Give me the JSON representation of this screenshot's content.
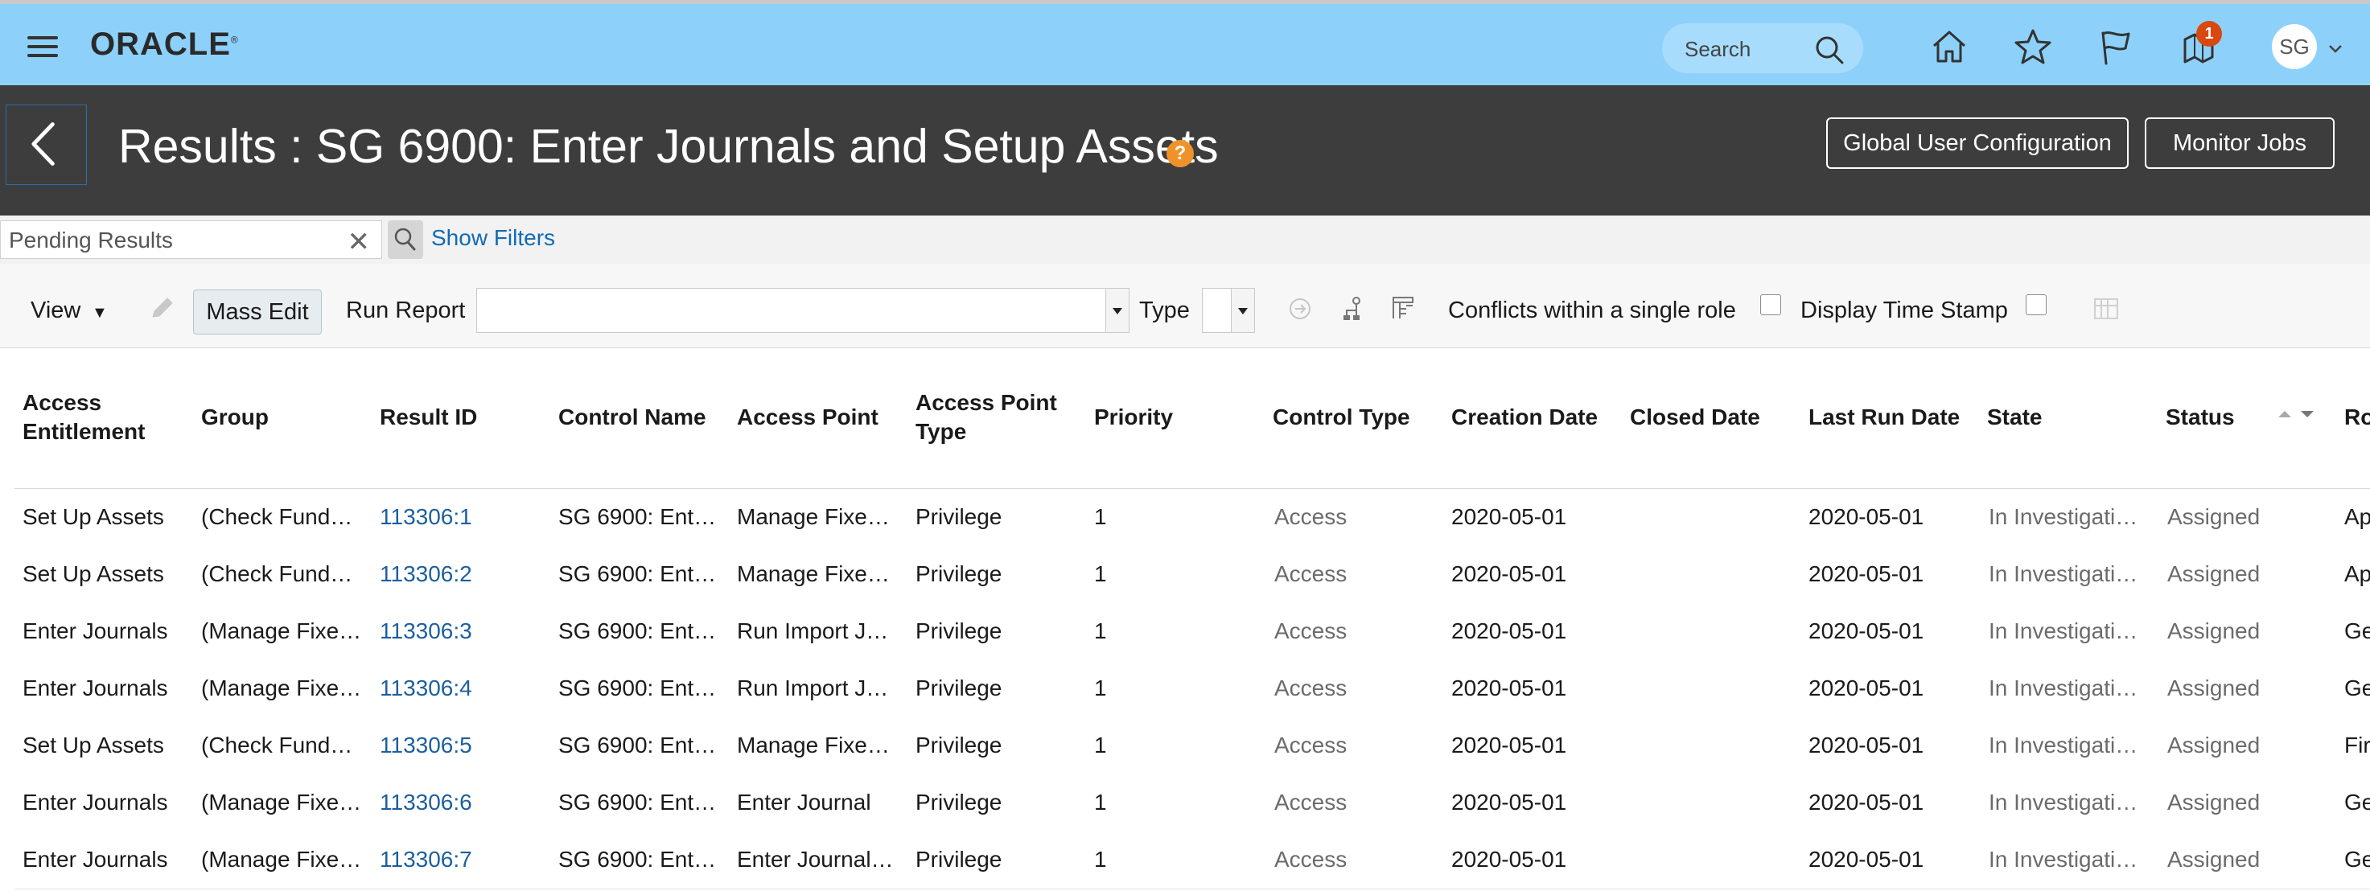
{
  "header": {
    "logo_text": "ORACLE",
    "search_placeholder": "Search",
    "notification_count": "1",
    "avatar_initials": "SG"
  },
  "titlebar": {
    "title": "Results : SG 6900: Enter Journals and Setup Assets",
    "help_glyph": "?",
    "global_config_label": "Global User Configuration",
    "monitor_jobs_label": "Monitor Jobs"
  },
  "filters": {
    "saved_search": "Pending Results",
    "show_filters_label": "Show Filters"
  },
  "toolbar": {
    "view_label": "View",
    "mass_edit_label": "Mass Edit",
    "run_report_label": "Run Report",
    "run_report_value": "",
    "type_label": "Type",
    "type_value": "",
    "conflicts_label": "Conflicts within a single role",
    "timestamp_label": "Display Time Stamp"
  },
  "table": {
    "columns": {
      "access_entitlement": "Access Entitlement",
      "group": "Group",
      "result_id": "Result ID",
      "control_name": "Control Name",
      "access_point": "Access Point",
      "access_point_type": "Access Point Type",
      "priority": "Priority",
      "control_type": "Control Type",
      "creation_date": "Creation Date",
      "closed_date": "Closed Date",
      "last_run_date": "Last Run Date",
      "state": "State",
      "status": "Status",
      "role_partial": "Ro"
    },
    "rows": [
      {
        "entitlement": "Set Up Assets",
        "group": "(Check Fund…",
        "result_id": "113306:1",
        "control": "SG 6900: Ent…",
        "access_point": "Manage Fixe…",
        "ap_type": "Privilege",
        "priority": "1",
        "control_type": "Access",
        "created": "2020-05-01",
        "closed": "",
        "last_run": "2020-05-01",
        "state": "In Investigati…",
        "status": "Assigned",
        "role": "Ap"
      },
      {
        "entitlement": "Set Up Assets",
        "group": "(Check Fund…",
        "result_id": "113306:2",
        "control": "SG 6900: Ent…",
        "access_point": "Manage Fixe…",
        "ap_type": "Privilege",
        "priority": "1",
        "control_type": "Access",
        "created": "2020-05-01",
        "closed": "",
        "last_run": "2020-05-01",
        "state": "In Investigati…",
        "status": "Assigned",
        "role": "Ap"
      },
      {
        "entitlement": "Enter Journals",
        "group": "(Manage Fixe…",
        "result_id": "113306:3",
        "control": "SG 6900: Ent…",
        "access_point": "Run Import J…",
        "ap_type": "Privilege",
        "priority": "1",
        "control_type": "Access",
        "created": "2020-05-01",
        "closed": "",
        "last_run": "2020-05-01",
        "state": "In Investigati…",
        "status": "Assigned",
        "role": "Ge"
      },
      {
        "entitlement": "Enter Journals",
        "group": "(Manage Fixe…",
        "result_id": "113306:4",
        "control": "SG 6900: Ent…",
        "access_point": "Run Import J…",
        "ap_type": "Privilege",
        "priority": "1",
        "control_type": "Access",
        "created": "2020-05-01",
        "closed": "",
        "last_run": "2020-05-01",
        "state": "In Investigati…",
        "status": "Assigned",
        "role": "Ge"
      },
      {
        "entitlement": "Set Up Assets",
        "group": "(Check Fund…",
        "result_id": "113306:5",
        "control": "SG 6900: Ent…",
        "access_point": "Manage Fixe…",
        "ap_type": "Privilege",
        "priority": "1",
        "control_type": "Access",
        "created": "2020-05-01",
        "closed": "",
        "last_run": "2020-05-01",
        "state": "In Investigati…",
        "status": "Assigned",
        "role": "Fir"
      },
      {
        "entitlement": "Enter Journals",
        "group": "(Manage Fixe…",
        "result_id": "113306:6",
        "control": "SG 6900: Ent…",
        "access_point": "Enter Journal",
        "ap_type": "Privilege",
        "priority": "1",
        "control_type": "Access",
        "created": "2020-05-01",
        "closed": "",
        "last_run": "2020-05-01",
        "state": "In Investigati…",
        "status": "Assigned",
        "role": "Ge"
      },
      {
        "entitlement": "Enter Journals",
        "group": "(Manage Fixe…",
        "result_id": "113306:7",
        "control": "SG 6900: Ent…",
        "access_point": "Enter Journal…",
        "ap_type": "Privilege",
        "priority": "1",
        "control_type": "Access",
        "created": "2020-05-01",
        "closed": "",
        "last_run": "2020-05-01",
        "state": "In Investigati…",
        "status": "Assigned",
        "role": "Ge"
      }
    ]
  }
}
